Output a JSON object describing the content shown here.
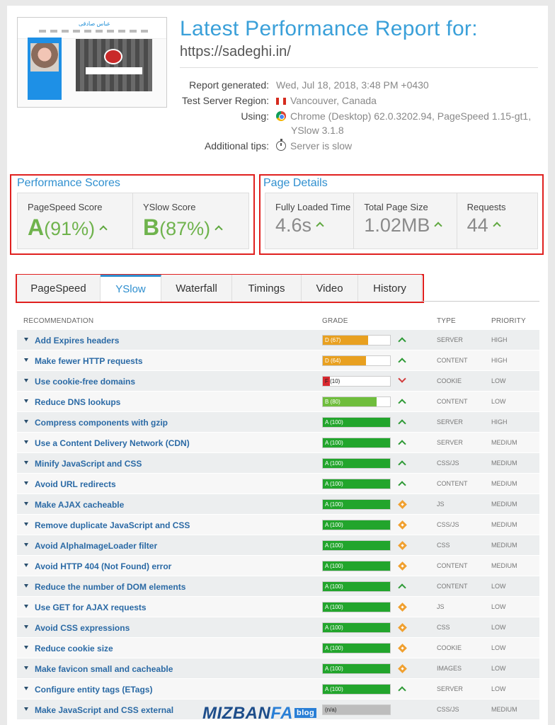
{
  "header": {
    "title": "Latest Performance Report for:",
    "url": "https://sadeghi.in/",
    "thumbnail_logo": "عباس صادقی",
    "meta": [
      {
        "key": "Report generated:",
        "value": "Wed, Jul 18, 2018, 3:48 PM +0430",
        "icon": ""
      },
      {
        "key": "Test Server Region:",
        "value": "Vancouver, Canada",
        "icon": "canada-flag-icon"
      },
      {
        "key": "Using:",
        "value": "Chrome (Desktop) 62.0.3202.94, PageSpeed 1.15-gt1,",
        "value2": "YSlow 3.1.8",
        "icon": "chrome-icon"
      },
      {
        "key": "Additional tips:",
        "value": "Server is slow",
        "icon": "stopwatch-icon"
      }
    ]
  },
  "performance": {
    "title": "Performance Scores",
    "pagespeed": {
      "label": "PageSpeed Score",
      "grade": "A",
      "pct": "(91%)"
    },
    "yslow": {
      "label": "YSlow Score",
      "grade": "B",
      "pct": "(87%)"
    }
  },
  "details": {
    "title": "Page Details",
    "items": [
      {
        "label": "Fully Loaded Time",
        "value": "4.6s"
      },
      {
        "label": "Total Page Size",
        "value": "1.02MB"
      },
      {
        "label": "Requests",
        "value": "44"
      }
    ]
  },
  "tabs": [
    "PageSpeed",
    "YSlow",
    "Waterfall",
    "Timings",
    "Video",
    "History"
  ],
  "active_tab": "YSlow",
  "table": {
    "headers": {
      "recommendation": "RECOMMENDATION",
      "grade": "GRADE",
      "type": "TYPE",
      "priority": "PRIORITY"
    },
    "rows": [
      {
        "name": "Add Expires headers",
        "grade": "D (67)",
        "score": 67,
        "color": "#e8a020",
        "trend": "up",
        "type": "SERVER",
        "priority": "HIGH"
      },
      {
        "name": "Make fewer HTTP requests",
        "grade": "D (64)",
        "score": 64,
        "color": "#e8a020",
        "trend": "up",
        "type": "CONTENT",
        "priority": "HIGH"
      },
      {
        "name": "Use cookie-free domains",
        "grade": "F (10)",
        "score": 10,
        "color": "#d9282f",
        "trend": "down",
        "type": "COOKIE",
        "priority": "LOW"
      },
      {
        "name": "Reduce DNS lookups",
        "grade": "B (80)",
        "score": 80,
        "color": "#6fbd3c",
        "trend": "up",
        "type": "CONTENT",
        "priority": "LOW"
      },
      {
        "name": "Compress components with gzip",
        "grade": "A (100)",
        "score": 100,
        "color": "#22a52c",
        "trend": "up",
        "type": "SERVER",
        "priority": "HIGH"
      },
      {
        "name": "Use a Content Delivery Network (CDN)",
        "grade": "A (100)",
        "score": 100,
        "color": "#22a52c",
        "trend": "up",
        "type": "SERVER",
        "priority": "MEDIUM"
      },
      {
        "name": "Minify JavaScript and CSS",
        "grade": "A (100)",
        "score": 100,
        "color": "#22a52c",
        "trend": "up",
        "type": "CSS/JS",
        "priority": "MEDIUM"
      },
      {
        "name": "Avoid URL redirects",
        "grade": "A (100)",
        "score": 100,
        "color": "#22a52c",
        "trend": "up",
        "type": "CONTENT",
        "priority": "MEDIUM"
      },
      {
        "name": "Make AJAX cacheable",
        "grade": "A (100)",
        "score": 100,
        "color": "#22a52c",
        "trend": "neutral",
        "type": "JS",
        "priority": "MEDIUM"
      },
      {
        "name": "Remove duplicate JavaScript and CSS",
        "grade": "A (100)",
        "score": 100,
        "color": "#22a52c",
        "trend": "neutral",
        "type": "CSS/JS",
        "priority": "MEDIUM"
      },
      {
        "name": "Avoid AlphaImageLoader filter",
        "grade": "A (100)",
        "score": 100,
        "color": "#22a52c",
        "trend": "neutral",
        "type": "CSS",
        "priority": "MEDIUM"
      },
      {
        "name": "Avoid HTTP 404 (Not Found) error",
        "grade": "A (100)",
        "score": 100,
        "color": "#22a52c",
        "trend": "neutral",
        "type": "CONTENT",
        "priority": "MEDIUM"
      },
      {
        "name": "Reduce the number of DOM elements",
        "grade": "A (100)",
        "score": 100,
        "color": "#22a52c",
        "trend": "up",
        "type": "CONTENT",
        "priority": "LOW"
      },
      {
        "name": "Use GET for AJAX requests",
        "grade": "A (100)",
        "score": 100,
        "color": "#22a52c",
        "trend": "neutral",
        "type": "JS",
        "priority": "LOW"
      },
      {
        "name": "Avoid CSS expressions",
        "grade": "A (100)",
        "score": 100,
        "color": "#22a52c",
        "trend": "neutral",
        "type": "CSS",
        "priority": "LOW"
      },
      {
        "name": "Reduce cookie size",
        "grade": "A (100)",
        "score": 100,
        "color": "#22a52c",
        "trend": "neutral",
        "type": "COOKIE",
        "priority": "LOW"
      },
      {
        "name": "Make favicon small and cacheable",
        "grade": "A (100)",
        "score": 100,
        "color": "#22a52c",
        "trend": "neutral",
        "type": "IMAGES",
        "priority": "LOW"
      },
      {
        "name": "Configure entity tags (ETags)",
        "grade": "A (100)",
        "score": 100,
        "color": "#22a52c",
        "trend": "up",
        "type": "SERVER",
        "priority": "LOW"
      },
      {
        "name": "Make JavaScript and CSS external",
        "grade": "(n/a)",
        "score": 100,
        "color": "#bdbdbd",
        "trend": "none",
        "type": "CSS/JS",
        "priority": "MEDIUM"
      }
    ]
  },
  "watermark": {
    "text1": "MIZBAN",
    "text2": "FA",
    "text3": "blog"
  }
}
